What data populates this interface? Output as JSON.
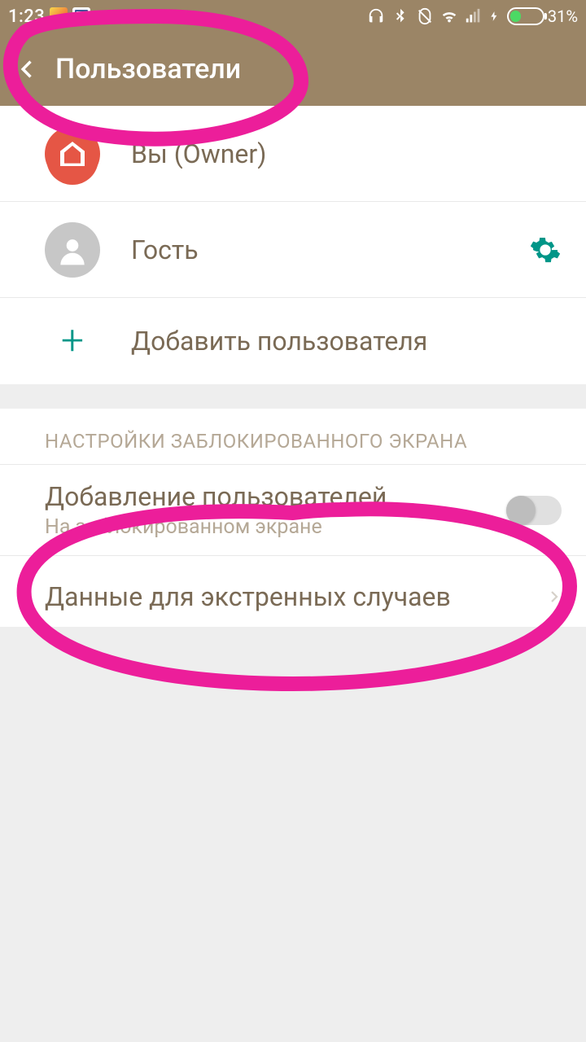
{
  "status_bar": {
    "time": "1:23",
    "battery_percent": "31%",
    "battery_fill_pct": 31
  },
  "header": {
    "title": "Пользователи"
  },
  "users": {
    "owner_label": "Вы (Owner)",
    "guest_label": "Гость",
    "add_user_label": "Добавить пользователя"
  },
  "lockscreen": {
    "section_header": "НАСТРОЙКИ ЗАБЛОКИРОВАННОГО ЭКРАНА",
    "add_users_title": "Добавление пользователей",
    "add_users_subtitle": "На заблокированном экране",
    "emergency_info": "Данные для экстренных случаев"
  }
}
